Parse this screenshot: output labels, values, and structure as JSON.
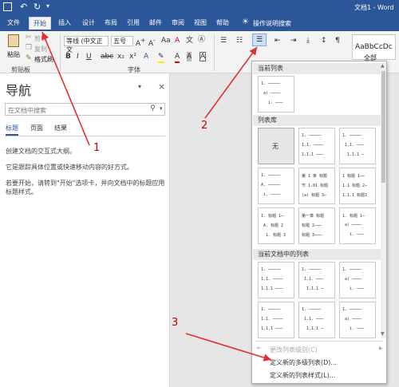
{
  "titlebar": {
    "doc_title": "文档1 - Word"
  },
  "tabs": [
    "文件",
    "开始",
    "插入",
    "设计",
    "布局",
    "引用",
    "邮件",
    "审阅",
    "视图",
    "帮助"
  ],
  "tell_me": "操作说明搜索",
  "ribbon": {
    "paste": "粘贴",
    "cut": "剪切",
    "copy": "复制",
    "format_painter": "格式刷",
    "clipboard_group": "剪贴板",
    "font_name": "等线 (中文正文",
    "font_size": "五号",
    "font_group": "字体",
    "style_preview": "AaBbCcDc",
    "all_label": "全部"
  },
  "nav": {
    "title": "导航",
    "search_placeholder": "在文档中搜索",
    "tabs": [
      "标题",
      "页面",
      "结果"
    ],
    "text1": "创建文档的交互式大纲。",
    "text2": "它是跟踪具体位置或快速移动内容的好方式。",
    "text3": "若要开始，请转到\"开始\"选项卡，并向文档中的标题应用标题样式。"
  },
  "dropdown": {
    "current_list": "当前列表",
    "list_library": "列表库",
    "none": "无",
    "doc_lists": "当前文档中的列表",
    "menu1": "更改列表级别(C)",
    "menu2": "定义新的多级列表(D)...",
    "menu3": "定义新的列表样式(L)..."
  },
  "annotations": [
    "1",
    "2",
    "3"
  ],
  "colors": {
    "accent": "#2b579a",
    "arrow": "#e03030"
  }
}
